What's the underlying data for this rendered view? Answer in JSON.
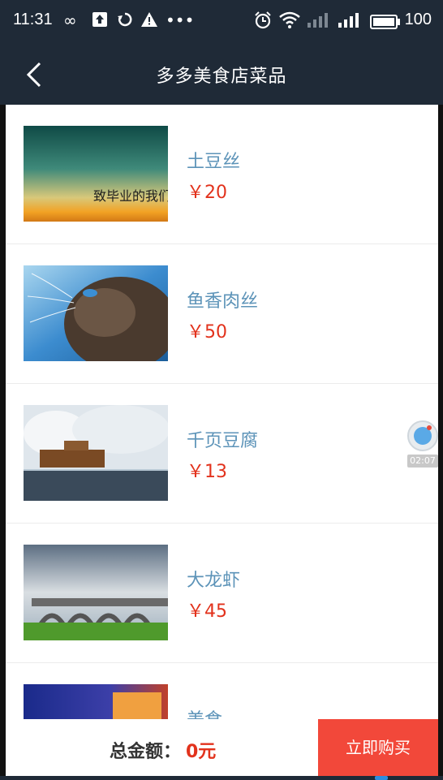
{
  "status_bar": {
    "time": "11:31",
    "icons": [
      "infinity-icon",
      "upload-icon",
      "sync-icon",
      "warning-icon",
      "more-dots-icon",
      "alarm-icon",
      "wifi-icon",
      "signal-weak-icon",
      "signal-icon",
      "battery-icon"
    ],
    "battery_level": "100"
  },
  "header": {
    "title": "多多美食店菜品",
    "back_icon": "chevron-left-icon"
  },
  "dishes": [
    {
      "name": "土豆丝",
      "price": "￥20",
      "image_caption": "致毕业的我们"
    },
    {
      "name": "鱼香肉丝",
      "price": "￥50"
    },
    {
      "name": "千页豆腐",
      "price": "￥13"
    },
    {
      "name": "大龙虾",
      "price": "￥45"
    },
    {
      "name": "美食",
      "price": ""
    }
  ],
  "floating_timer": {
    "time": "02:07"
  },
  "footer": {
    "total_label": "总金额：",
    "total_value": "0元",
    "buy_label": "立即购买"
  },
  "colors": {
    "header_bg": "#1f2a37",
    "name_color": "#5c93b8",
    "price_color": "#e2321c",
    "buy_bg": "#f2483a"
  }
}
